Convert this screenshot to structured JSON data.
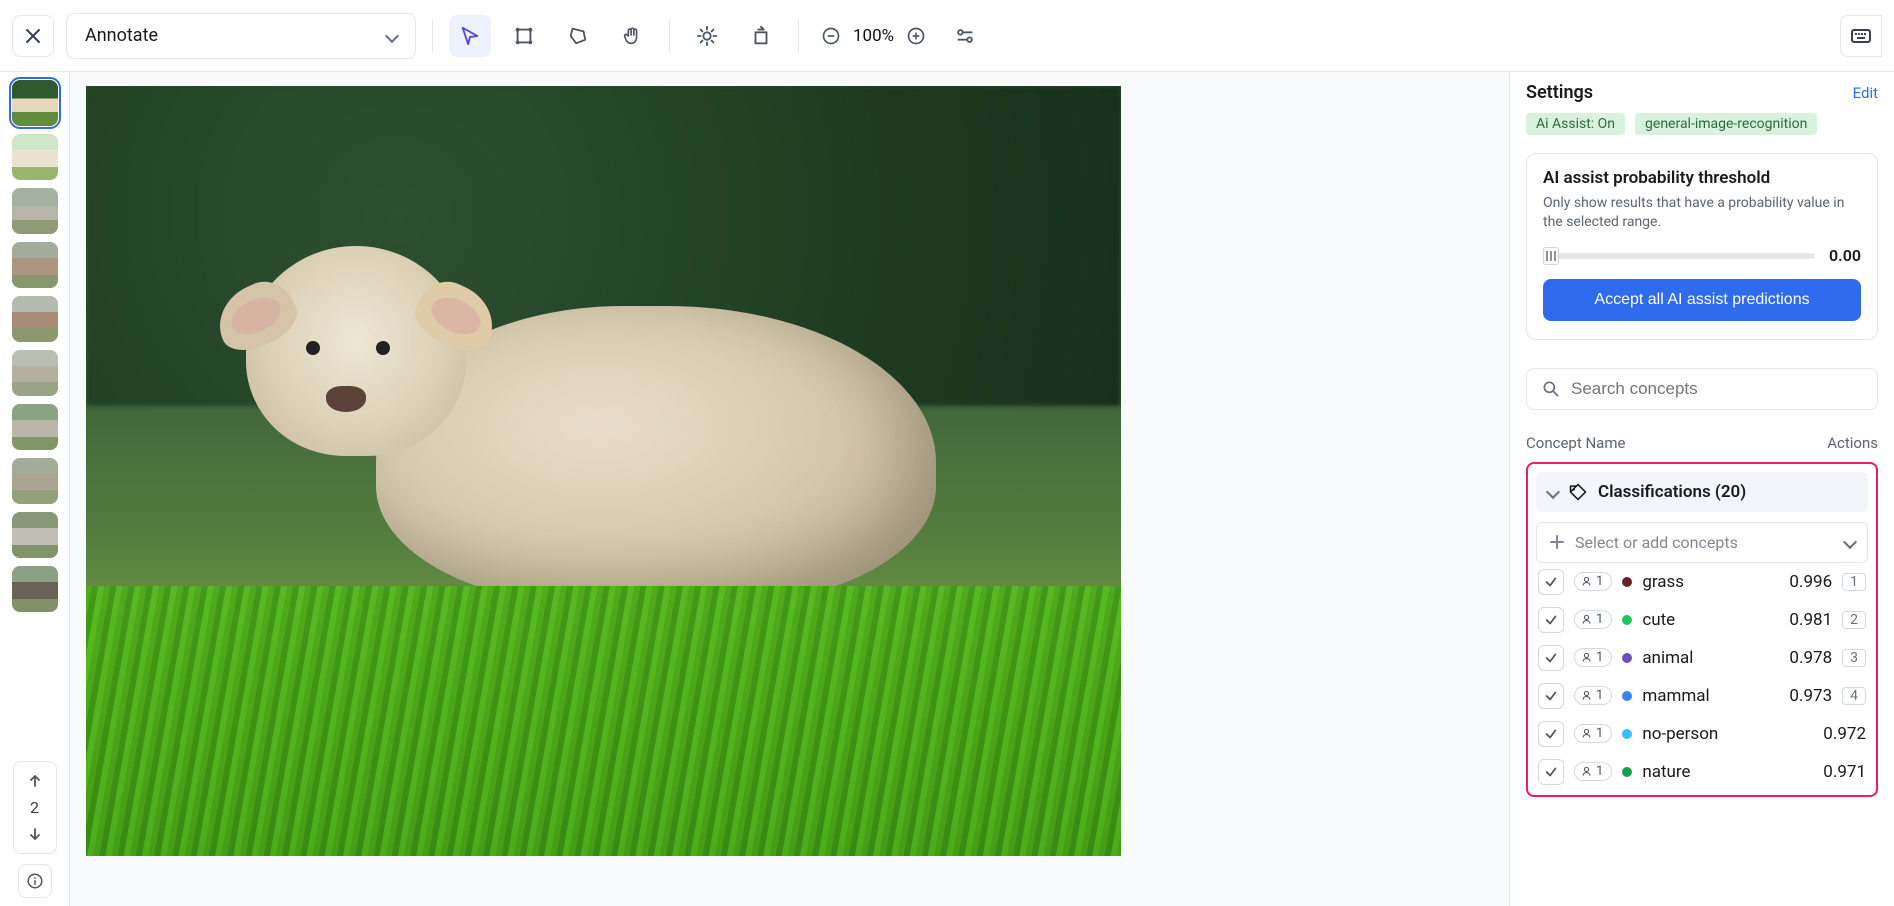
{
  "toolbar": {
    "mode_label": "Annotate",
    "zoom_level": "100%"
  },
  "strip": {
    "current_index": "2",
    "thumbnail_count": 10
  },
  "settings": {
    "title": "Settings",
    "edit": "Edit",
    "ai_assist_badge": "Ai Assist: On",
    "model_badge": "general-image-recognition",
    "threshold_title": "AI assist probability threshold",
    "threshold_desc": "Only show results that have a probability value in the selected range.",
    "threshold_value": "0.00",
    "accept_label": "Accept all AI assist predictions"
  },
  "search": {
    "placeholder": "Search concepts"
  },
  "table": {
    "col_concept": "Concept Name",
    "col_actions": "Actions"
  },
  "classifications": {
    "header": "Classifications (20)",
    "add_placeholder": "Select or add concepts",
    "items": [
      {
        "name": "grass",
        "score": "0.996",
        "shortcut": "1",
        "user_count": "1",
        "color": "#6b1f2a"
      },
      {
        "name": "cute",
        "score": "0.981",
        "shortcut": "2",
        "user_count": "1",
        "color": "#22c55e"
      },
      {
        "name": "animal",
        "score": "0.978",
        "shortcut": "3",
        "user_count": "1",
        "color": "#6b4fbf"
      },
      {
        "name": "mammal",
        "score": "0.973",
        "shortcut": "4",
        "user_count": "1",
        "color": "#3b82f6"
      },
      {
        "name": "no-person",
        "score": "0.972",
        "shortcut": "",
        "user_count": "1",
        "color": "#38bdf8"
      },
      {
        "name": "nature",
        "score": "0.971",
        "shortcut": "",
        "user_count": "1",
        "color": "#16a34a"
      }
    ]
  }
}
